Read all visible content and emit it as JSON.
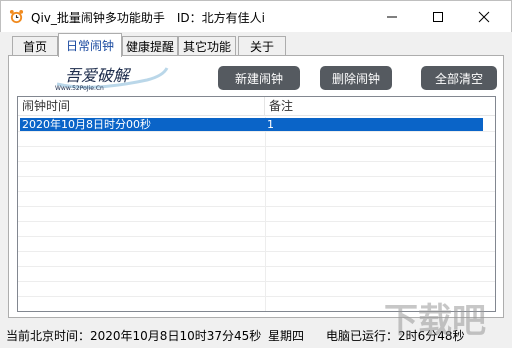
{
  "window": {
    "title": "Qiv_批量闹钟多功能助手　ID：北方有佳人i"
  },
  "icons": {
    "app": "alarm-clock-icon",
    "minimize": "minimize-icon",
    "maximize": "maximize-icon",
    "close": "close-icon"
  },
  "tabs": [
    {
      "label": "首页"
    },
    {
      "label": "日常闹钟"
    },
    {
      "label": "健康提醒"
    },
    {
      "label": "其它功能"
    },
    {
      "label": "关于"
    }
  ],
  "toolbar": {
    "logo_text": "吾爱破解",
    "logo_sub": "Www.52PoJie.Cn",
    "new_label": "新建闹钟",
    "delete_label": "删除闹钟",
    "clear_label": "全部清空"
  },
  "list": {
    "columns": [
      "闹钟时间",
      "备注"
    ],
    "rows": [
      {
        "time": "2020年10月8日时分00秒",
        "note": "1",
        "selected": true
      }
    ]
  },
  "status": {
    "now": "当前北京时间：2020年10月8日10时37分45秒",
    "weekday": "星期四",
    "uptime": "电脑已运行：2时6分48秒"
  },
  "watermark": {
    "text": "下载吧"
  },
  "colors": {
    "accent": "#1a4aa0",
    "selection": "#0a64c8",
    "button": "#555a60",
    "icon_orange": "#f08a1e"
  }
}
